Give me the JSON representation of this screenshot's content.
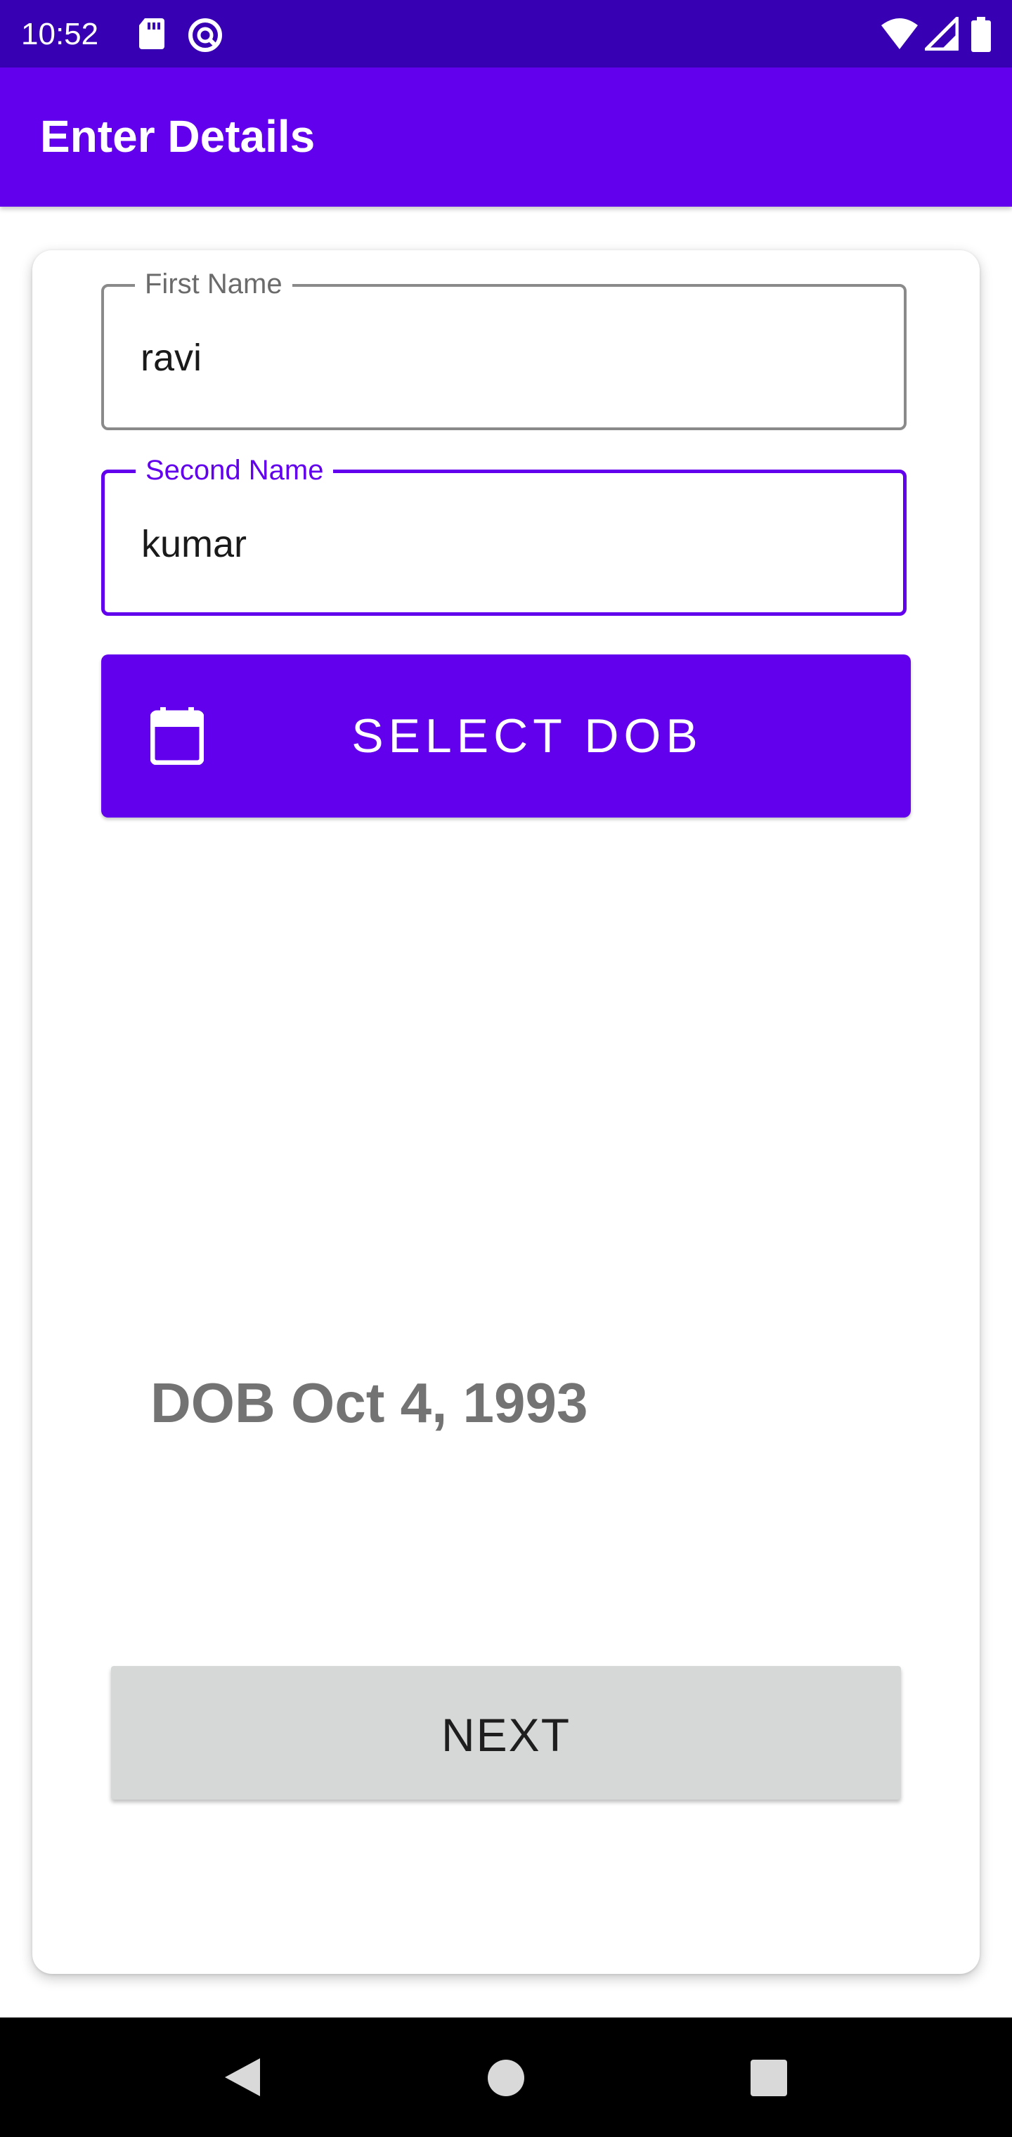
{
  "status_bar": {
    "time": "10:52",
    "icons": [
      "sd-card-icon",
      "vpn-icon",
      "wifi-icon",
      "signal-icon",
      "battery-icon"
    ],
    "background": "#3700b3"
  },
  "app_bar": {
    "title": "Enter Details",
    "background": "#6200ee"
  },
  "form": {
    "first_name": {
      "label": "First Name",
      "value": "ravi"
    },
    "second_name": {
      "label": "Second Name",
      "value": "kumar",
      "focused": true
    },
    "select_dob_button": {
      "label": "SELECT DOB",
      "icon": "calendar-icon"
    },
    "dob_text": "DOB Oct 4, 1993",
    "next_button": {
      "label": "NEXT"
    }
  },
  "nav_bar": {
    "buttons": [
      "back-icon",
      "home-icon",
      "recents-icon"
    ]
  },
  "colors": {
    "accent": "#6200ee",
    "status_bar": "#3700b3",
    "next_button_bg": "#d6d7d7",
    "dob_text": "#737373"
  }
}
